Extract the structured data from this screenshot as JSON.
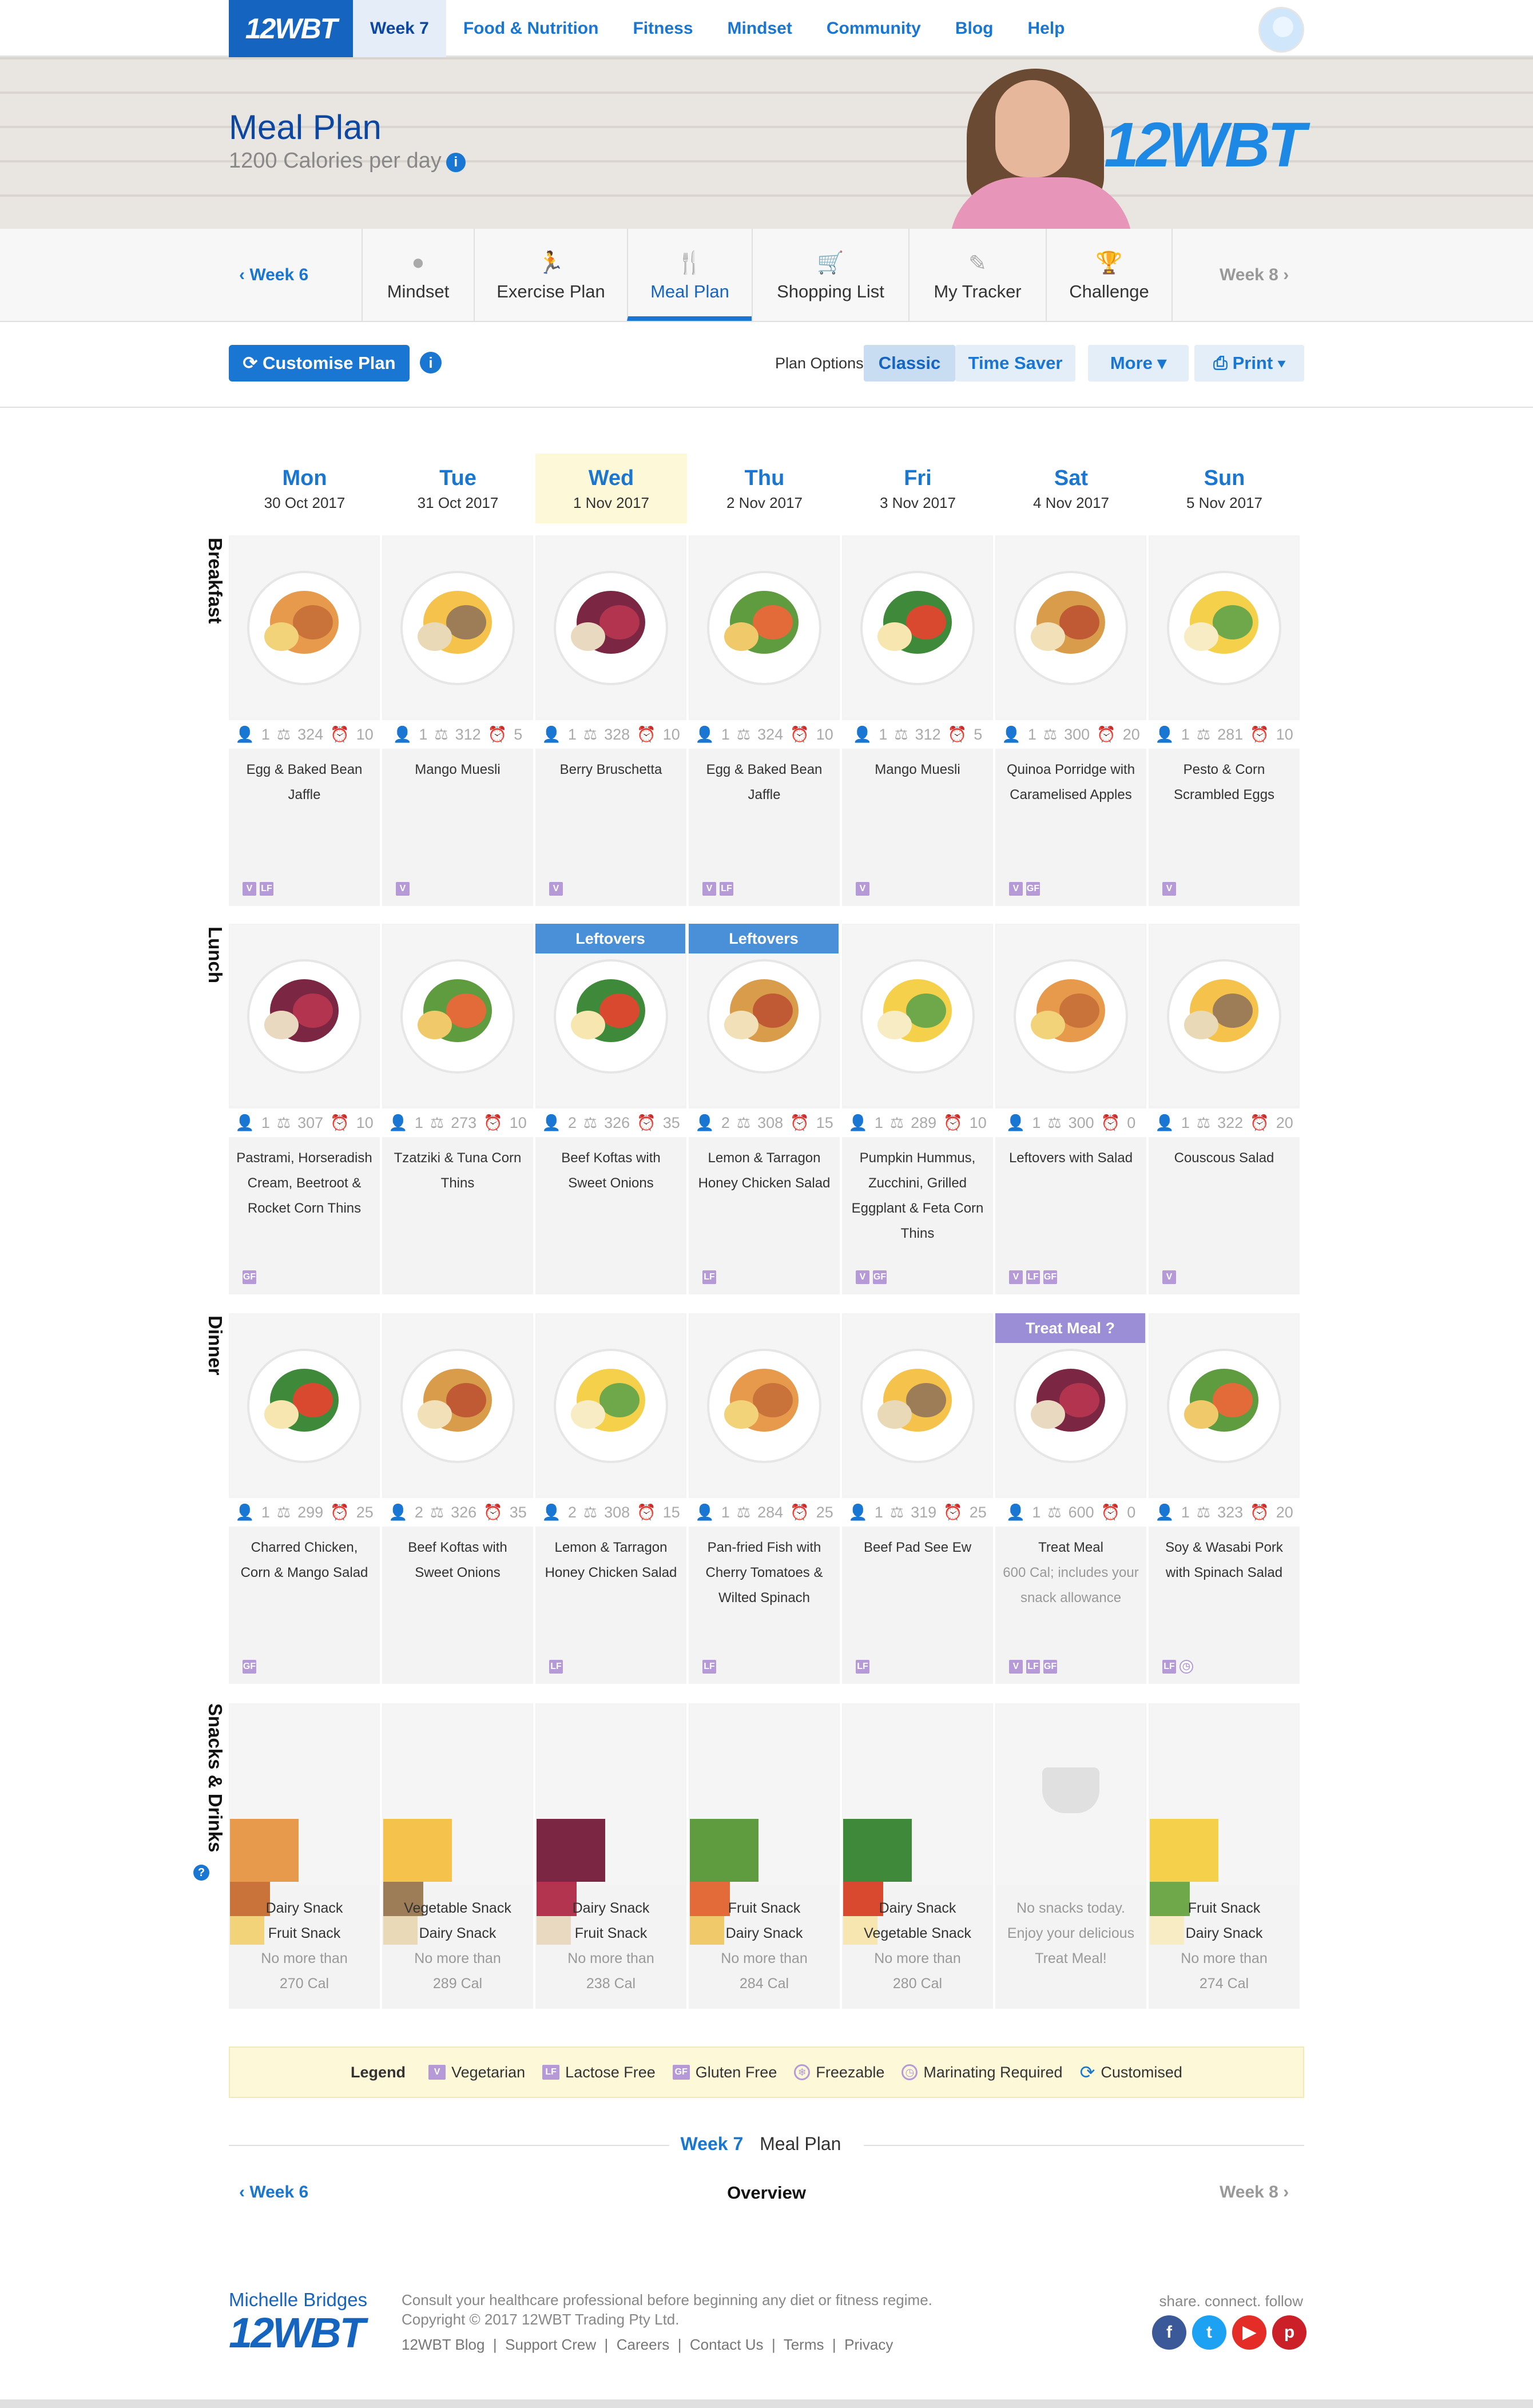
{
  "nav": {
    "logo": "12WBT",
    "items": [
      "Week 7",
      "Food & Nutrition",
      "Fitness",
      "Mindset",
      "Community",
      "Blog",
      "Help"
    ]
  },
  "hero": {
    "title": "Meal Plan",
    "subtitle": "1200 Calories per day",
    "logo": "12WBT"
  },
  "subnav": {
    "prev": "Week 6",
    "next": "Week 8",
    "items": [
      "Mindset",
      "Exercise Plan",
      "Meal Plan",
      "Shopping List",
      "My Tracker",
      "Challenge"
    ],
    "active": "Meal Plan"
  },
  "toolbar": {
    "customise": "Customise Plan",
    "plan_options_label": "Plan Options",
    "classic": "Classic",
    "time_saver": "Time Saver",
    "more": "More",
    "print": "Print"
  },
  "days": [
    {
      "name": "Mon",
      "date": "30 Oct 2017"
    },
    {
      "name": "Tue",
      "date": "31 Oct 2017"
    },
    {
      "name": "Wed",
      "date": "1 Nov 2017"
    },
    {
      "name": "Thu",
      "date": "2 Nov 2017"
    },
    {
      "name": "Fri",
      "date": "3 Nov 2017"
    },
    {
      "name": "Sat",
      "date": "4 Nov 2017"
    },
    {
      "name": "Sun",
      "date": "5 Nov 2017"
    }
  ],
  "rows": {
    "breakfast": "Breakfast",
    "lunch": "Lunch",
    "dinner": "Dinner",
    "snacks": "Snacks & Drinks"
  },
  "breakfast": [
    {
      "serves": "1",
      "cal": "324",
      "time": "10",
      "name": "Egg & Baked Bean Jaffle",
      "tags": [
        "V",
        "LF"
      ]
    },
    {
      "serves": "1",
      "cal": "312",
      "time": "5",
      "name": "Mango Muesli",
      "tags": [
        "V"
      ]
    },
    {
      "serves": "1",
      "cal": "328",
      "time": "10",
      "name": "Berry Bruschetta",
      "tags": [
        "V"
      ]
    },
    {
      "serves": "1",
      "cal": "324",
      "time": "10",
      "name": "Egg & Baked Bean Jaffle",
      "tags": [
        "V",
        "LF"
      ]
    },
    {
      "serves": "1",
      "cal": "312",
      "time": "5",
      "name": "Mango Muesli",
      "tags": [
        "V"
      ]
    },
    {
      "serves": "1",
      "cal": "300",
      "time": "20",
      "name": "Quinoa Porridge with Caramelised Apples",
      "tags": [
        "V",
        "GF"
      ]
    },
    {
      "serves": "1",
      "cal": "281",
      "time": "10",
      "name": "Pesto & Corn Scrambled Eggs",
      "tags": [
        "V"
      ]
    }
  ],
  "lunch": [
    {
      "serves": "1",
      "cal": "307",
      "time": "10",
      "name": "Pastrami, Horseradish Cream, Beetroot & Rocket Corn Thins",
      "tags": [
        "GF"
      ]
    },
    {
      "serves": "1",
      "cal": "273",
      "time": "10",
      "name": "Tzatziki & Tuna Corn Thins",
      "tags": []
    },
    {
      "serves": "2",
      "cal": "326",
      "time": "35",
      "name": "Beef Koftas with Sweet Onions",
      "tags": [],
      "badge": "Leftovers"
    },
    {
      "serves": "2",
      "cal": "308",
      "time": "15",
      "name": "Lemon & Tarragon Honey Chicken Salad",
      "tags": [
        "LF"
      ],
      "badge": "Leftovers"
    },
    {
      "serves": "1",
      "cal": "289",
      "time": "10",
      "name": "Pumpkin Hummus, Zucchini, Grilled Eggplant & Feta Corn Thins",
      "tags": [
        "V",
        "GF"
      ]
    },
    {
      "serves": "1",
      "cal": "300",
      "time": "0",
      "name": "Leftovers with Salad",
      "tags": [
        "V",
        "LF",
        "GF"
      ]
    },
    {
      "serves": "1",
      "cal": "322",
      "time": "20",
      "name": "Couscous Salad",
      "tags": [
        "V"
      ]
    }
  ],
  "dinner": [
    {
      "serves": "1",
      "cal": "299",
      "time": "25",
      "name": "Charred Chicken, Corn & Mango Salad",
      "tags": [
        "GF"
      ]
    },
    {
      "serves": "2",
      "cal": "326",
      "time": "35",
      "name": "Beef Koftas with Sweet Onions",
      "tags": []
    },
    {
      "serves": "2",
      "cal": "308",
      "time": "15",
      "name": "Lemon & Tarragon Honey Chicken Salad",
      "tags": [
        "LF"
      ]
    },
    {
      "serves": "1",
      "cal": "284",
      "time": "25",
      "name": "Pan-fried Fish with Cherry Tomatoes & Wilted Spinach",
      "tags": [
        "LF"
      ]
    },
    {
      "serves": "1",
      "cal": "319",
      "time": "25",
      "name": "Beef Pad See Ew",
      "tags": [
        "LF"
      ]
    },
    {
      "serves": "1",
      "cal": "600",
      "time": "0",
      "name": "Treat Meal",
      "note": "600 Cal; includes your snack allowance",
      "tags": [
        "V",
        "LF",
        "GF"
      ],
      "badge": "Treat Meal ?"
    },
    {
      "serves": "1",
      "cal": "323",
      "time": "20",
      "name": "Soy & Wasabi Pork with Spinach Salad",
      "tags": [
        "LF",
        "M"
      ]
    }
  ],
  "snacks": [
    {
      "lines": [
        "Dairy Snack",
        "Fruit Snack",
        "No more than",
        "270 Cal"
      ]
    },
    {
      "lines": [
        "Vegetable Snack",
        "Dairy Snack",
        "No more than",
        "289 Cal"
      ]
    },
    {
      "lines": [
        "Dairy Snack",
        "Fruit Snack",
        "No more than",
        "238 Cal"
      ]
    },
    {
      "lines": [
        "Fruit Snack",
        "Dairy Snack",
        "No more than",
        "284 Cal"
      ]
    },
    {
      "lines": [
        "Dairy Snack",
        "Vegetable Snack",
        "No more than",
        "280 Cal"
      ]
    },
    {
      "lines": [
        "No snacks today.",
        "Enjoy your delicious",
        "Treat Meal!"
      ],
      "empty": true
    },
    {
      "lines": [
        "Fruit Snack",
        "Dairy Snack",
        "No more than",
        "274 Cal"
      ]
    }
  ],
  "legend": {
    "title": "Legend",
    "items": [
      "Vegetarian",
      "Lactose Free",
      "Gluten Free",
      "Freezable",
      "Marinating Required",
      "Customised"
    ]
  },
  "bottom": {
    "week": "Week 7",
    "meal_plan": "Meal Plan",
    "prev": "Week 6",
    "overview": "Overview",
    "next": "Week 8"
  },
  "footer": {
    "brand_line": "Michelle Bridges",
    "brand_logo": "12WBT",
    "disclaimer": "Consult your healthcare professional before beginning any diet or fitness regime.",
    "copyright": "Copyright © 2017 12WBT Trading Pty Ltd.",
    "links": [
      "12WBT Blog",
      "Support Crew",
      "Careers",
      "Contact Us",
      "Terms",
      "Privacy"
    ],
    "social_label": "share. connect. follow"
  },
  "colors": {
    "brand": "#1976d2",
    "tag": "#b69ad8",
    "leftovers": "#4a90d9",
    "treat": "#9b8ed6"
  }
}
